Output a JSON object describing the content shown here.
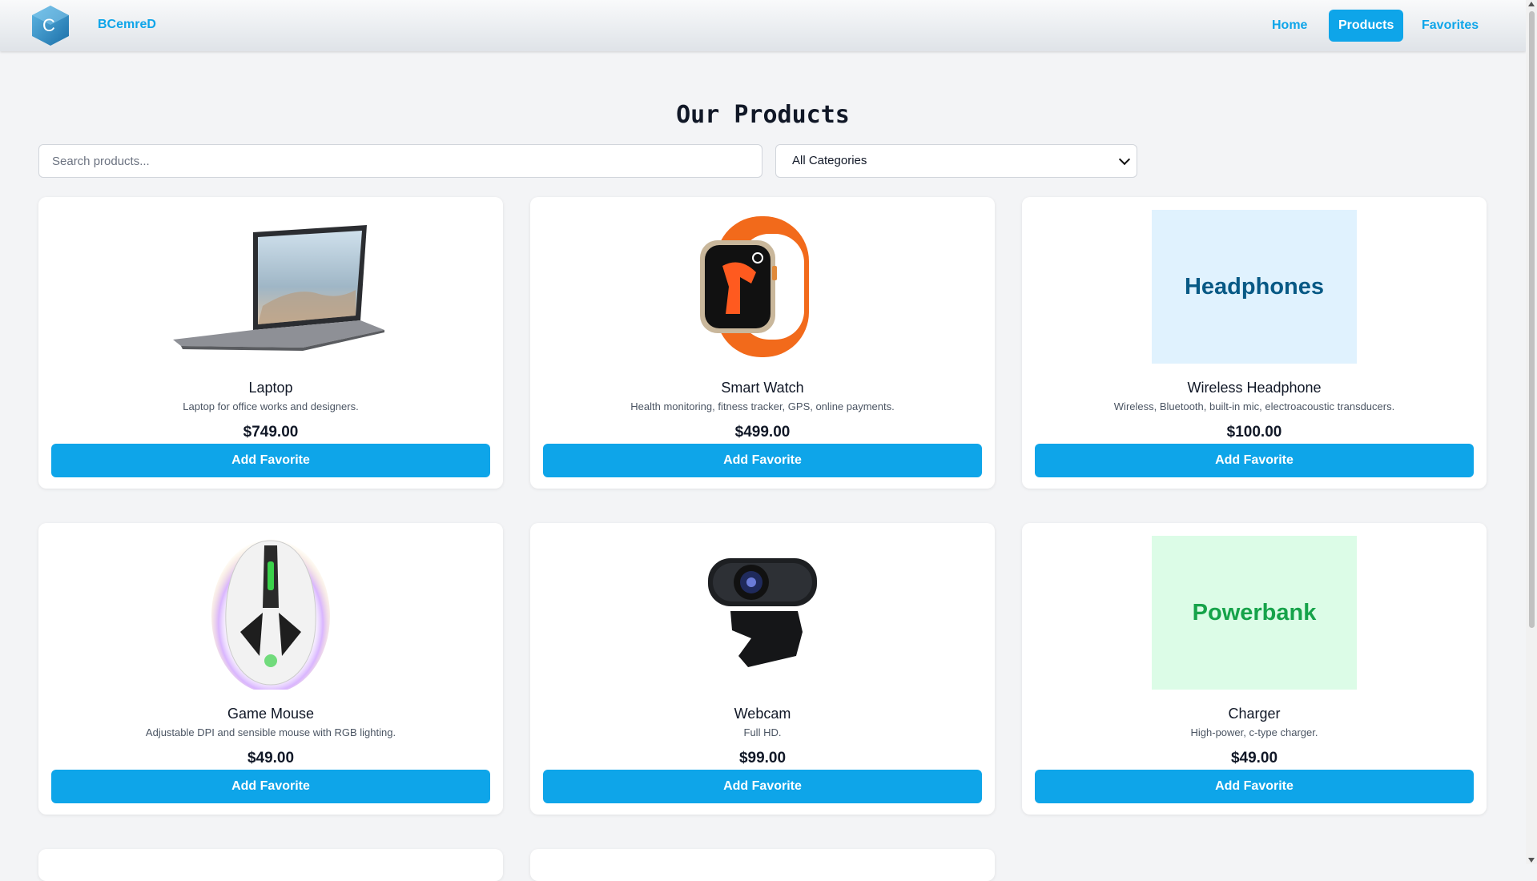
{
  "nav": {
    "brand": "BCemreD",
    "logo_letter": "C",
    "links": [
      {
        "label": "Home",
        "active": false
      },
      {
        "label": "Products",
        "active": true
      },
      {
        "label": "Favorites",
        "active": false
      }
    ]
  },
  "page": {
    "title": "Our Products",
    "search_placeholder": "Search products...",
    "category_selected": "All Categories"
  },
  "products": [
    {
      "name": "Laptop",
      "description": "Laptop for office works and designers.",
      "price": "$749.00",
      "button": "Add Favorite",
      "image": "laptop-image"
    },
    {
      "name": "Smart Watch",
      "description": "Health monitoring, fitness tracker, GPS, online payments.",
      "price": "$499.00",
      "button": "Add Favorite",
      "image": "smartwatch-image"
    },
    {
      "name": "Wireless Headphone",
      "description": "Wireless, Bluetooth, built-in mic, electroacoustic transducers.",
      "price": "$100.00",
      "button": "Add Favorite",
      "image_text": "Headphones"
    },
    {
      "name": "Game Mouse",
      "description": "Adjustable DPI and sensible mouse with RGB lighting.",
      "price": "$49.00",
      "button": "Add Favorite",
      "image": "gaming-mouse-image"
    },
    {
      "name": "Webcam",
      "description": "Full HD.",
      "price": "$99.00",
      "button": "Add Favorite",
      "image": "webcam-image"
    },
    {
      "name": "Charger",
      "description": "High-power, c-type charger.",
      "price": "$49.00",
      "button": "Add Favorite",
      "image_text": "Powerbank"
    }
  ],
  "colors": {
    "accent": "#0ea5e9",
    "headphones_bg": "#e0f2fe",
    "headphones_text": "#075985",
    "powerbank_bg": "#dcfce7",
    "powerbank_text": "#16a34a"
  }
}
